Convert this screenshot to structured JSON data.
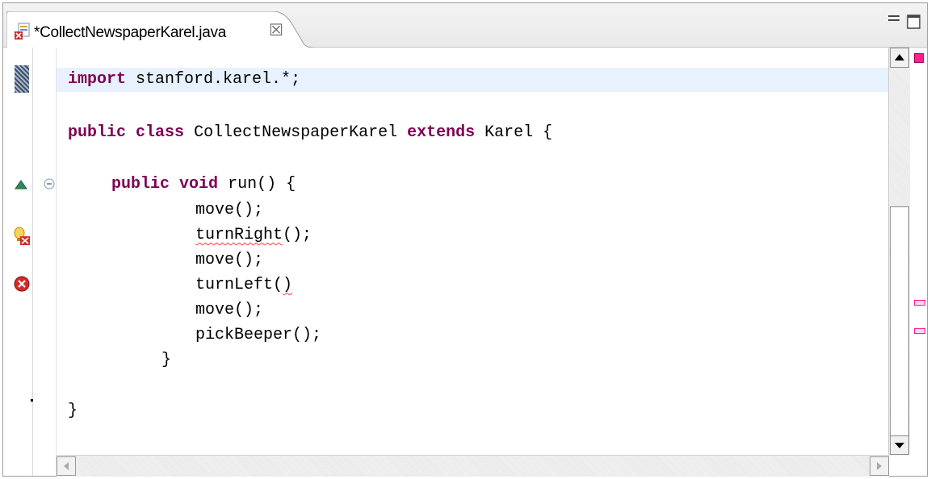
{
  "tab": {
    "title": "*CollectNewspaperKarel.java",
    "close_glyph": "☒",
    "file_icon": "java-file-with-error-icon"
  },
  "window_controls": {
    "minimize": "minimize-icon",
    "maximize": "maximize-icon"
  },
  "code_lines": [
    "import stanford.karel.*;",
    "",
    "public class CollectNewspaperKarel extends Karel {",
    "",
    "public void run() {",
    "move();",
    "turnRight();",
    "move();",
    "turnLeft()",
    "move();",
    "pickBeeper();",
    "}",
    "",
    "",
    "}"
  ],
  "colors": {
    "keyword": "#7f0055",
    "current_line": "#e8f2fe",
    "error_underline": "#ff3838",
    "overview_error": "#ff1f8f"
  },
  "gutter_markers": {
    "line1": "import-marker",
    "line5": "override-triangle-icon",
    "line7": "quickfix-error-icon",
    "line9": "error-icon"
  }
}
